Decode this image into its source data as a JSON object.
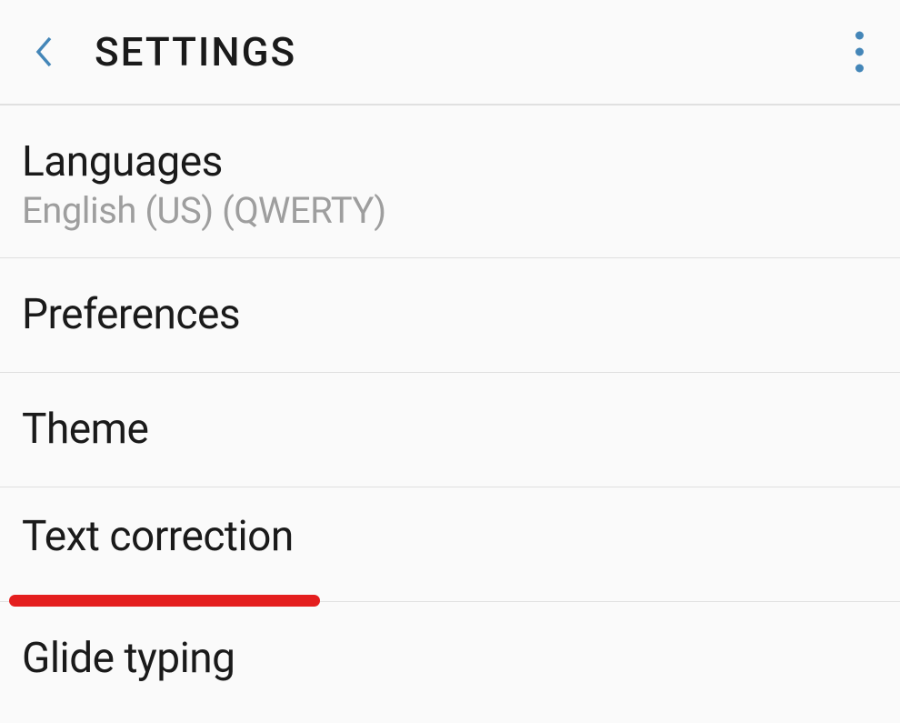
{
  "header": {
    "title": "SETTINGS"
  },
  "items": [
    {
      "title": "Languages",
      "subtitle": "English (US) (QWERTY)"
    },
    {
      "title": "Preferences"
    },
    {
      "title": "Theme"
    },
    {
      "title": "Text correction"
    },
    {
      "title": "Glide typing"
    }
  ]
}
